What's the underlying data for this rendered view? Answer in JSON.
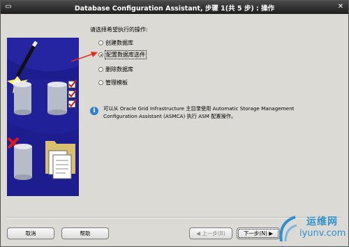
{
  "window": {
    "title": "Database Configuration Assistant, 步骤 1(共 5 步) : 操作",
    "menu_icon": "window-menu-icon",
    "close_icon": "close-icon"
  },
  "main": {
    "instruction": "请选择希望执行的操作:",
    "options": [
      {
        "label": "创建数据库",
        "selected": false
      },
      {
        "label": "配置数据库选件",
        "selected": true
      },
      {
        "label": "删除数据库",
        "selected": false
      },
      {
        "label": "管理模板",
        "selected": false
      }
    ],
    "info_line1": "可以从 Oracle Grid Infrastructure 主目录使用 Automatic Storage Management",
    "info_line2": "Configuration Assistant (ASMCA) 执行 ASM 配置操作。"
  },
  "footer": {
    "cancel_label": "取消",
    "help_label": "帮助",
    "back_label": "上一步(B)",
    "next_label": "下一步(N)"
  },
  "watermark": {
    "title": "运维网",
    "url": "iyunv.com"
  },
  "colors": {
    "panel": "#1d1d8f",
    "arrow": "#e03020",
    "watermark": "#2f8fcf"
  }
}
